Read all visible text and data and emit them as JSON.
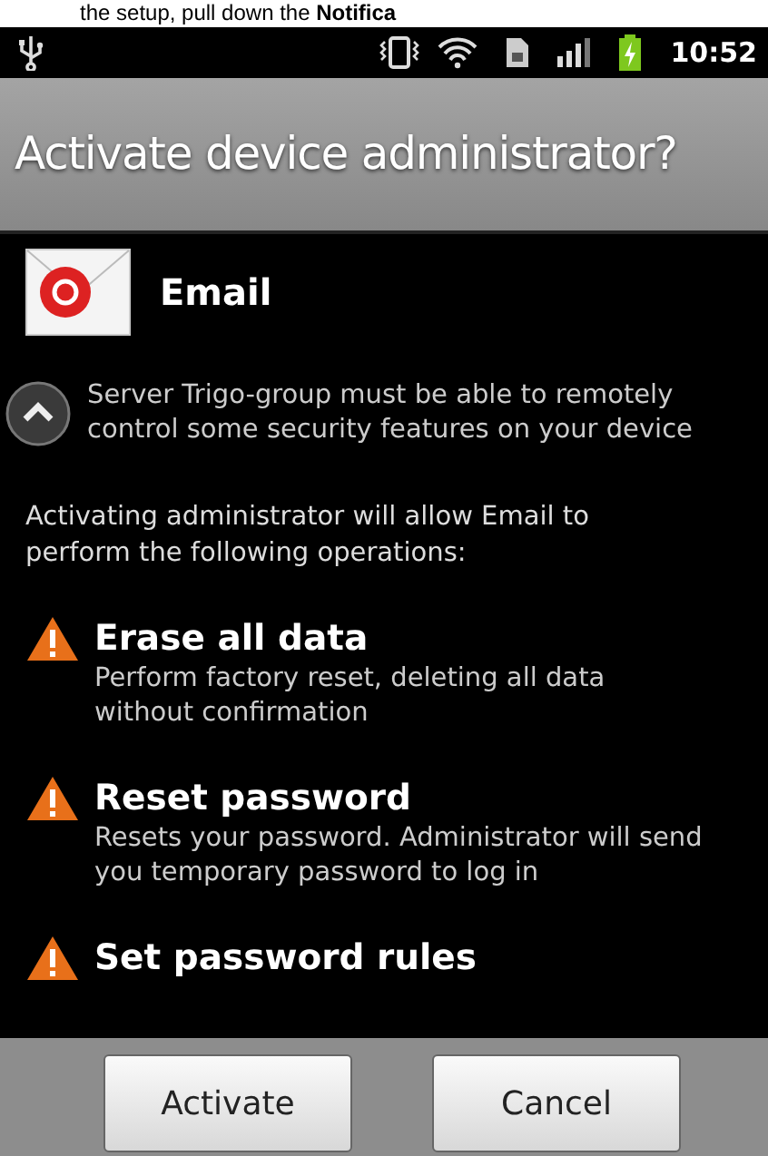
{
  "caption": "the setup, pull down the **Notifica**",
  "status_bar": {
    "time": "10:52"
  },
  "dialog": {
    "title": "Activate device administrator?",
    "app": {
      "name": "Email"
    },
    "description": "Server Trigo-group must be able to remotely control some security features on your device",
    "details_expanded": true,
    "intro": "Activating administrator will allow Email to perform the following operations:",
    "operations": [
      {
        "title": "Erase all data",
        "detail": "Perform factory reset, deleting all data without confirmation"
      },
      {
        "title": "Reset password",
        "detail": "Resets your password. Administrator will send you temporary password to log in"
      },
      {
        "title": "Set password rules"
      }
    ],
    "buttons": [
      "Activate",
      "Cancel"
    ]
  }
}
